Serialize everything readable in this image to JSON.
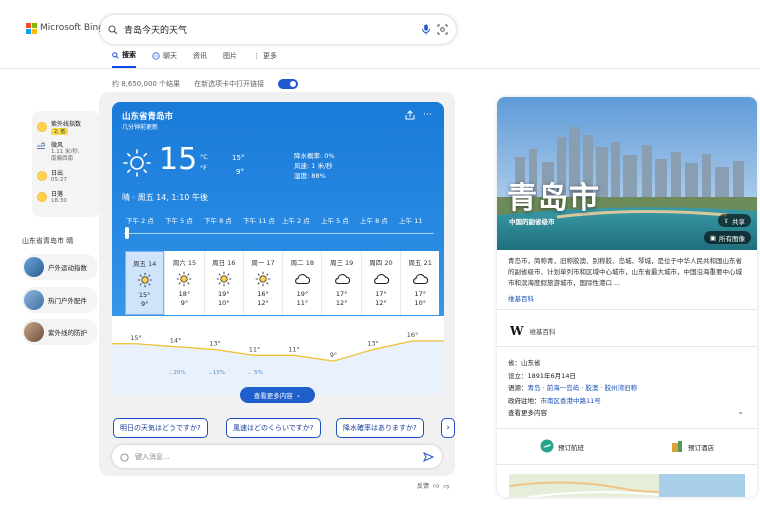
{
  "brand": {
    "logo_text": "Microsoft Bing"
  },
  "search": {
    "query": "青岛今天的天气"
  },
  "tabs": [
    {
      "label": "搜索",
      "icon": "search-icon",
      "active": true
    },
    {
      "label": "聊天",
      "icon": "chat-icon",
      "active": false
    },
    {
      "label": "资讯",
      "icon": "",
      "active": false
    },
    {
      "label": "图片",
      "icon": "",
      "active": false
    },
    {
      "label": "更多",
      "icon": "more-vertical-icon",
      "active": false
    }
  ],
  "result_info": {
    "count": "约 8,650,000 个结果",
    "toggle_label": "在新选项卡中打开链接",
    "toggle_on": true
  },
  "sidebar": {
    "weather_items": [
      {
        "icon": "sun-icon",
        "label": "紫外线指数",
        "badge": "2, 低",
        "sub": ""
      },
      {
        "icon": "wind-icon",
        "label": "微风",
        "badge": "",
        "sub": "1.11 米/秒,\n南偏西南"
      },
      {
        "icon": "sunrise-icon",
        "label": "日出",
        "badge": "",
        "sub": "05:27"
      },
      {
        "icon": "sunset-icon",
        "label": "日落",
        "badge": "",
        "sub": "18:30"
      }
    ],
    "section_title": "山东省青岛市 晴",
    "links": [
      "户外运动指数",
      "热门户外配件",
      "紫外线的防护"
    ]
  },
  "weather": {
    "location": "山东省青岛市",
    "sub": "几分钟前更新",
    "current_temp": "15",
    "unit_c": "°C",
    "unit_f": "°F",
    "high": "15°",
    "low": "9°",
    "precip": "降水概率: 0%",
    "wind": "风速: 1 米/秒",
    "humidity": "湿度: 88%",
    "date_line": "晴 · 周五 14, 1:10 午後",
    "hours": [
      "下午 2 点",
      "下午 5 点",
      "下午 8 点",
      "下午 11 点",
      "上午 2 点",
      "上午 5 点",
      "上午 8 点",
      "上午 11"
    ],
    "days": [
      {
        "name": "周五 14",
        "icon": "sun-icon",
        "hi": "15°",
        "lo": "9°"
      },
      {
        "name": "周六 15",
        "icon": "sun-icon",
        "hi": "18°",
        "lo": "9°"
      },
      {
        "name": "周日 16",
        "icon": "sun-icon",
        "hi": "19°",
        "lo": "10°"
      },
      {
        "name": "周一 17",
        "icon": "sun-icon",
        "hi": "16°",
        "lo": "12°"
      },
      {
        "name": "周二 18",
        "icon": "cloud-icon",
        "hi": "19°",
        "lo": "11°"
      },
      {
        "name": "周三 19",
        "icon": "cloud-icon",
        "hi": "17°",
        "lo": "12°"
      },
      {
        "name": "周四 20",
        "icon": "cloud-icon",
        "hi": "17°",
        "lo": "12°"
      },
      {
        "name": "周五 21",
        "icon": "cloud-icon",
        "hi": "17°",
        "lo": "10°"
      }
    ],
    "see_more": "查看更多内容"
  },
  "chart_data": {
    "type": "line",
    "x": [
      "下午 2 点",
      "下午 5 点",
      "下午 8 点",
      "下午 11 点",
      "上午 2 点",
      "上午 5 点",
      "上午 8 点",
      "上午 11"
    ],
    "values": [
      15,
      14,
      13,
      11,
      11,
      9,
      13,
      16
    ],
    "point_labels": [
      "15°",
      "14°",
      "13°",
      "11°",
      "11°",
      "9°",
      "13°",
      "16°"
    ],
    "precip_labels": [
      "",
      "20%",
      "15%",
      "5%",
      "",
      "",
      "",
      ""
    ],
    "ylim": [
      0,
      20
    ],
    "grid": false
  },
  "suggestions": [
    "明日の天気はどうですか?",
    "風速はどのくらいですか?",
    "降水確率はありますか?"
  ],
  "chat_input": {
    "placeholder": "键入消息..."
  },
  "feedback": {
    "label": "反馈"
  },
  "knowledge": {
    "title": "青岛市",
    "subtitle": "中国的副省级市",
    "share": "共享",
    "all_images": "所有图像",
    "description": "青岛市，简称青，旧称胶澳、别称胶、岛城、琴城，是位于中华人民共和国山东省的副省级市、计划单列市和区域中心城市，山东省最大城市，中国沿海重要中心城市和滨海度假旅游城市，国际性港口 ...",
    "more_link": "维基百科",
    "source_label": "维基百科",
    "facts": [
      {
        "label": "省",
        "value": "山东省",
        "links": []
      },
      {
        "label": "设立",
        "value": "1891年6月14日",
        "links": []
      },
      {
        "label": "语源",
        "value": "青岛 · 前海一岛屿 · 胶澳 · 胶州湾旧称",
        "links": [
          "前海一岛屿",
          "胶州湾旧称"
        ]
      },
      {
        "label": "政府驻地",
        "value": "市南区香港中路11号",
        "links": [
          "市南区香港中路11号"
        ]
      }
    ],
    "see_more": "查看更多内容",
    "actions": [
      {
        "label": "预订航班",
        "icon": "plane-icon"
      },
      {
        "label": "预订酒店",
        "icon": "hotel-icon"
      }
    ]
  }
}
